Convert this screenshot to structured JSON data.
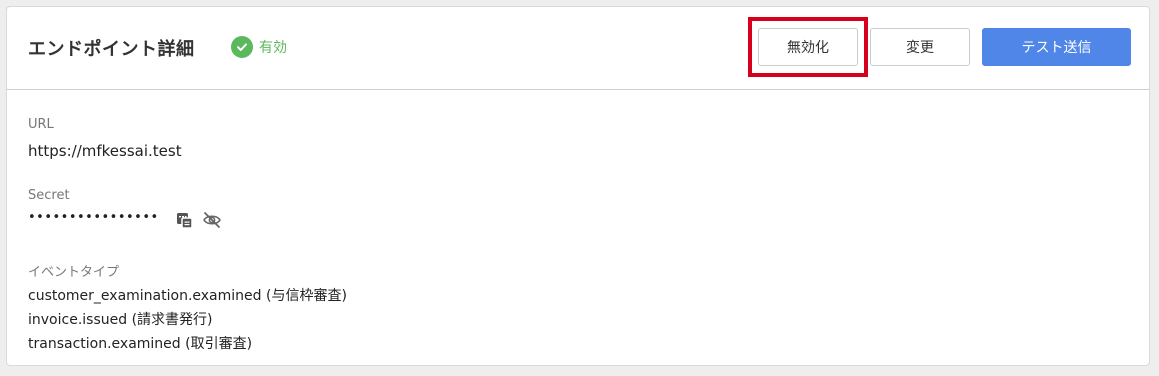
{
  "header": {
    "title": "エンドポイント詳細",
    "status_label": "有効",
    "buttons": {
      "disable_label": "無効化",
      "edit_label": "変更",
      "test_send_label": "テスト送信"
    }
  },
  "fields": {
    "url": {
      "label": "URL",
      "value": "https://mfkessai.test"
    },
    "secret": {
      "label": "Secret",
      "value": "••••••••••••••••"
    },
    "event_types": {
      "label": "イベントタイプ",
      "items": [
        "customer_examination.examined (与信枠審査)",
        "invoice.issued (請求書発行)",
        "transaction.examined (取引審査)"
      ]
    }
  },
  "colors": {
    "status_green": "#5cb85c",
    "primary_blue": "#4f86e8",
    "highlight_red": "#d6001c"
  },
  "icons": {
    "status": "check-circle-icon",
    "copy": "copy-icon",
    "visibility": "eye-off-icon"
  }
}
